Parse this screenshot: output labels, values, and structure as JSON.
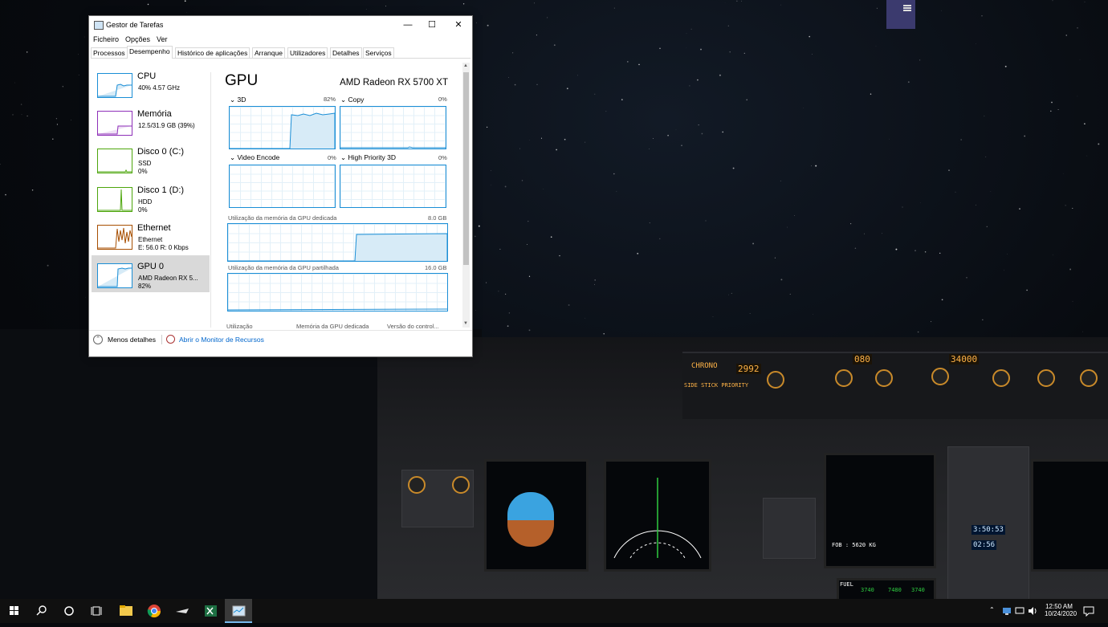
{
  "task_manager": {
    "title": "Gestor de Tarefas",
    "window_controls": {
      "minimize": "—",
      "maximize": "☐",
      "close": "✕"
    },
    "menu": [
      "Ficheiro",
      "Opções",
      "Ver"
    ],
    "tabs": [
      "Processos",
      "Desempenho",
      "Histórico de aplicações",
      "Arranque",
      "Utilizadores",
      "Detalhes",
      "Serviços"
    ],
    "selected_tab": "Desempenho",
    "sidebar": [
      {
        "name": "CPU",
        "line1": "40%  4.57 GHz",
        "line2": "",
        "color": "#1a8ed6"
      },
      {
        "name": "Memória",
        "line1": "12.5/31.9 GB (39%)",
        "line2": "",
        "color": "#8e2fb8"
      },
      {
        "name": "Disco 0 (C:)",
        "line1": "SSD",
        "line2": "0%",
        "color": "#4da60c"
      },
      {
        "name": "Disco 1 (D:)",
        "line1": "HDD",
        "line2": "0%",
        "color": "#4da60c"
      },
      {
        "name": "Ethernet",
        "line1": "Ethernet",
        "line2": "E: 56.0  R: 0 Kbps",
        "color": "#a74f01"
      },
      {
        "name": "GPU 0",
        "line1": "AMD Radeon RX 5...",
        "line2": "82%",
        "color": "#1a8ed6",
        "selected": true
      }
    ],
    "main": {
      "heading": "GPU",
      "device": "AMD Radeon RX 5700 XT",
      "engines": [
        {
          "label": "3D",
          "pct": "82%"
        },
        {
          "label": "Copy",
          "pct": "0%"
        },
        {
          "label": "Video Encode",
          "pct": "0%"
        },
        {
          "label": "High Priority 3D",
          "pct": "0%"
        }
      ],
      "dedicated_label": "Utilização da memória da GPU dedicada",
      "dedicated_max": "8.0 GB",
      "shared_label": "Utilização da memória da GPU partilhada",
      "shared_max": "16.0 GB",
      "stats_headers": [
        "Utilização",
        "Memória da GPU dedicada",
        "Versão do control..."
      ]
    },
    "footer": {
      "less_details": "Menos detalhes",
      "resource_monitor": "Abrir o Monitor de Recursos"
    }
  },
  "cockpit": {
    "fcu_hdg": "080",
    "fcu_alt": "34000",
    "efis_left": "2992",
    "chrono": "CHRONO",
    "side_stick": "SIDE STICK PRIORITY",
    "clock1": "3:50:53",
    "clock2": "02:56",
    "fob": "FOB : 5620 KG",
    "fuel_label": "FUEL",
    "fuel_left": "3740",
    "fuel_right": "3740",
    "fuel_used": "7480"
  },
  "taskbar": {
    "time": "12:50 AM",
    "date": "10/24/2020",
    "apps": [
      "start",
      "search",
      "cortana",
      "task-view",
      "file-explorer",
      "chrome",
      "flight-sim",
      "excel",
      "task-manager"
    ]
  }
}
